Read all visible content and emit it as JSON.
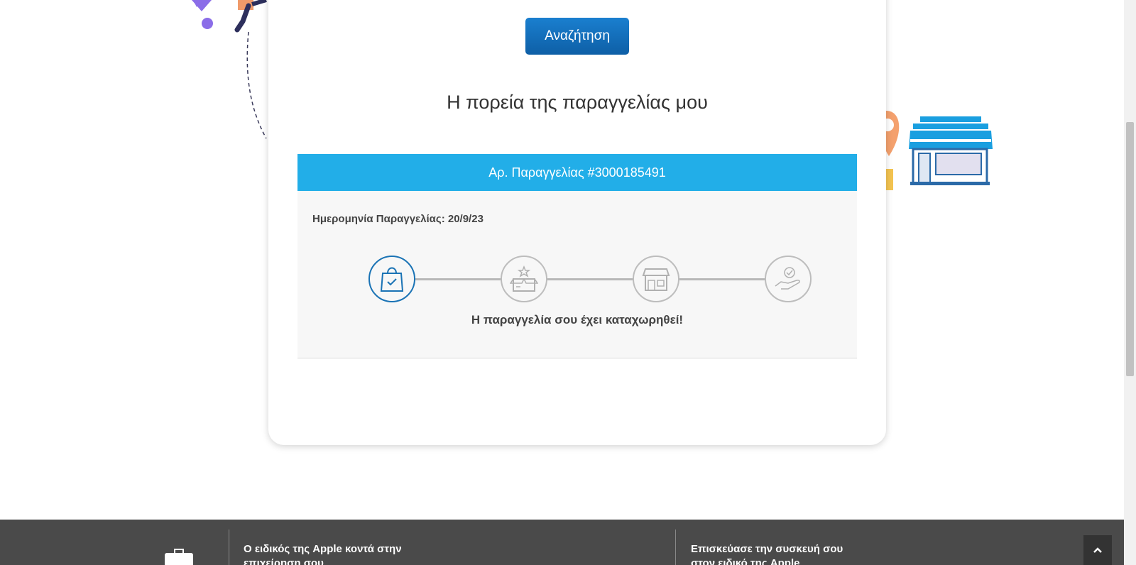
{
  "search": {
    "button_label": "Αναζήτηση"
  },
  "tracking": {
    "title": "Η πορεία της παραγγελίας μου",
    "order_number_label": "Αρ. Παραγγελίας #3000185491",
    "order_date_label": "Ημερομηνία Παραγγελίας: 20/9/23",
    "status_message": "Η παραγγελία σου έχει καταχωρηθεί!",
    "steps": [
      {
        "icon": "shopping-bag-check-icon",
        "active": true
      },
      {
        "icon": "open-box-icon",
        "active": false
      },
      {
        "icon": "store-icon",
        "active": false
      },
      {
        "icon": "hand-check-icon",
        "active": false
      }
    ]
  },
  "footer": {
    "col1_text": "Ο ειδικός της Apple κοντά στην επιχείρηση σου",
    "col2_text": "Επισκεύασε την συσκευή σου στον ειδικό της Apple"
  },
  "colors": {
    "accent": "#22aee8",
    "button": "#1a7fcf",
    "footer_bg": "#4a4a4a"
  }
}
